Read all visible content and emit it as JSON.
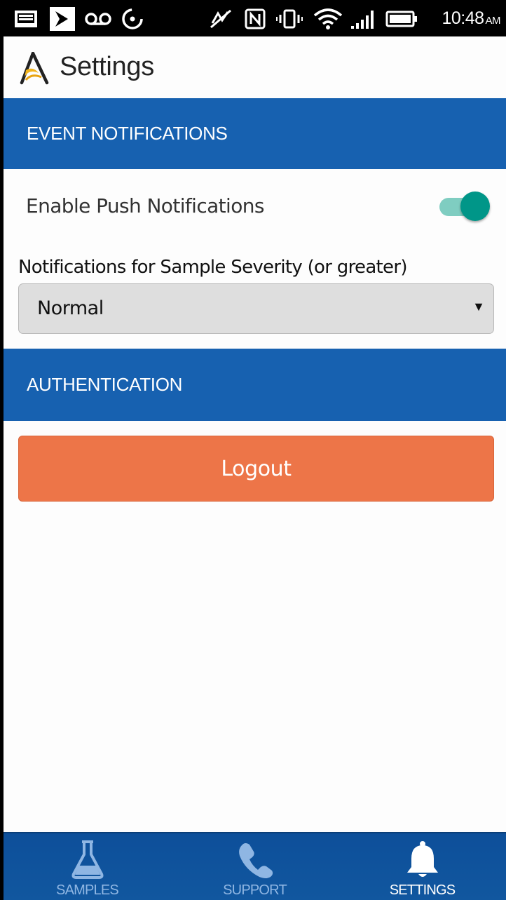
{
  "status_bar": {
    "time": "10:48",
    "ampm": "AM",
    "icons": [
      "gallery-icon",
      "sprint-icon",
      "voicemail-icon",
      "sync-icon",
      "signal-off-icon",
      "nfc-icon",
      "vibrate-icon",
      "wifi-icon",
      "cell-signal-icon",
      "battery-icon"
    ]
  },
  "header": {
    "title": "Settings",
    "logo_icon": "app-logo-icon"
  },
  "sections": {
    "events": {
      "title": "EVENT NOTIFICATIONS"
    },
    "auth": {
      "title": "AUTHENTICATION"
    }
  },
  "push": {
    "label": "Enable Push Notifications",
    "enabled": true
  },
  "severity": {
    "label": "Notifications for Sample Severity (or greater)",
    "value": "Normal"
  },
  "logout": {
    "label": "Logout"
  },
  "bottom_nav": {
    "tabs": [
      {
        "label": "SAMPLES",
        "icon": "flask-icon",
        "active": false
      },
      {
        "label": "SUPPORT",
        "icon": "phone-icon",
        "active": false
      },
      {
        "label": "SETTINGS",
        "icon": "bell-icon",
        "active": true
      }
    ]
  },
  "colors": {
    "section_blue": "#1761b0",
    "logout_orange": "#ed7548",
    "toggle_teal": "#009688",
    "nav_blue": "#0d4f9a"
  }
}
